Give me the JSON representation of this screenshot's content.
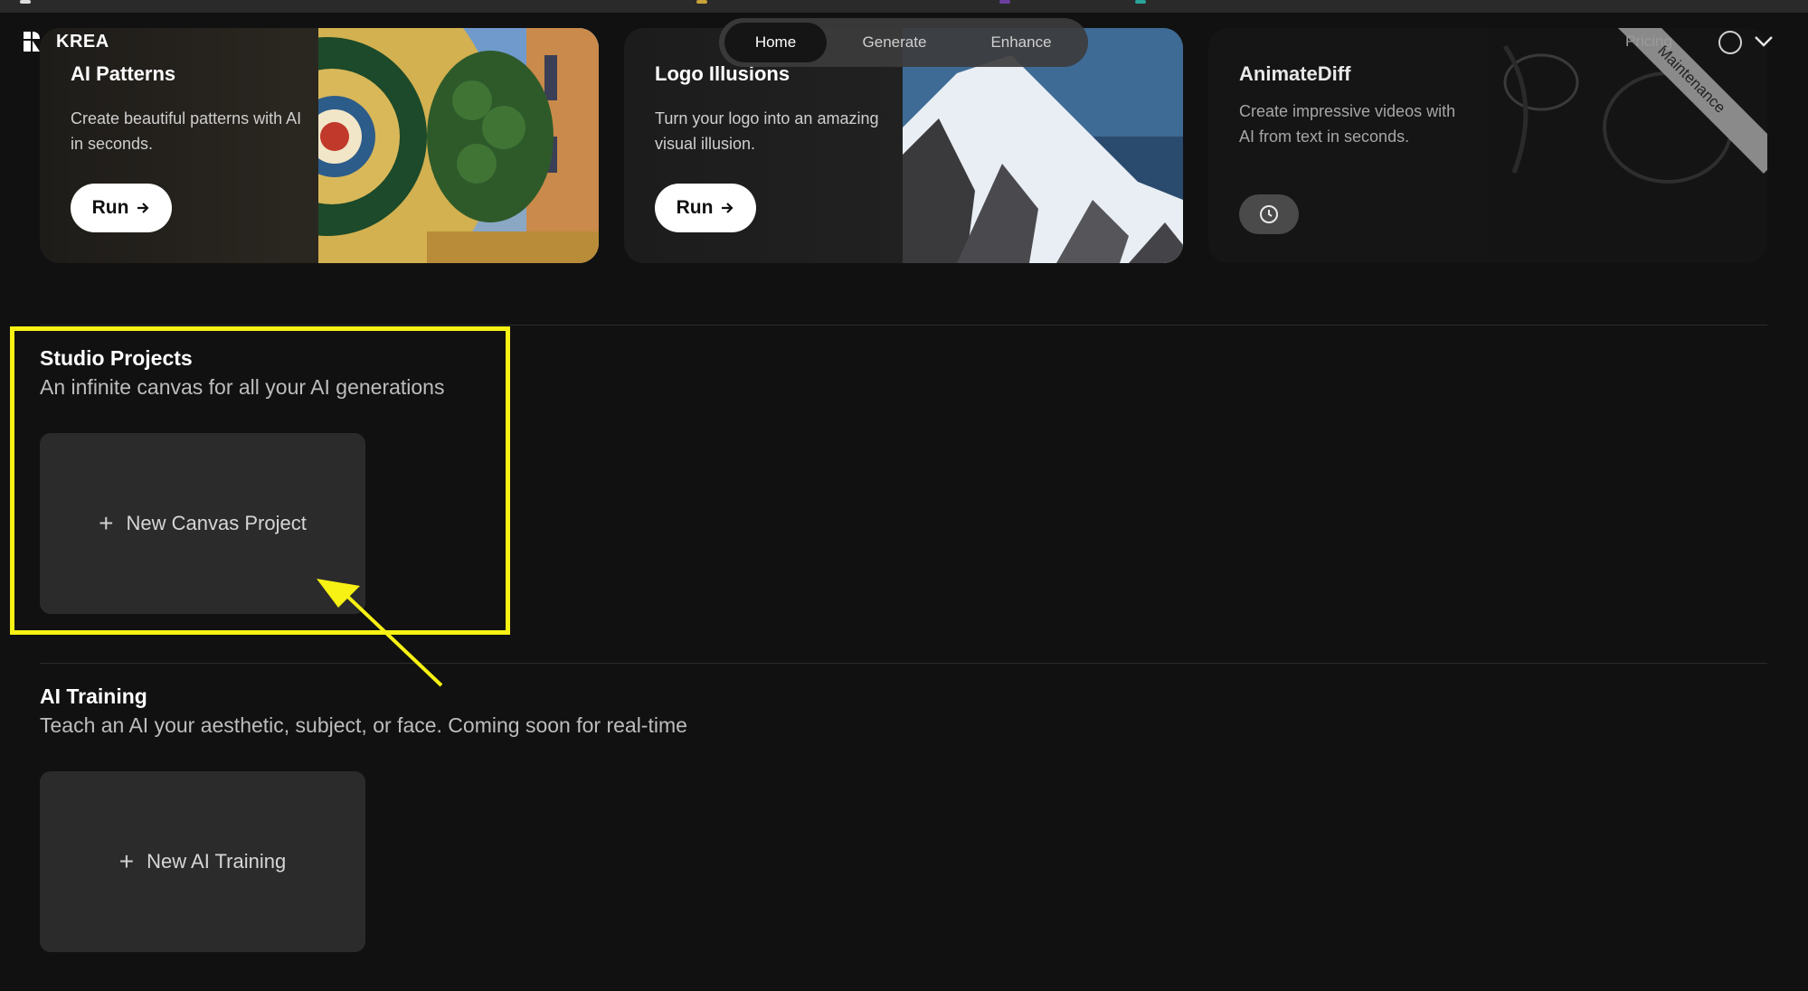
{
  "app": {
    "brand": "KREA"
  },
  "nav": {
    "tabs": [
      "Home",
      "Generate",
      "Enhance"
    ],
    "active": "Home",
    "pricing": "Pricing"
  },
  "cards": [
    {
      "title": "AI Patterns",
      "description": "Create beautiful patterns with AI in seconds.",
      "button": "Run"
    },
    {
      "title": "Logo Illusions",
      "description": "Turn your logo into an amazing visual illusion.",
      "button": "Run"
    },
    {
      "title": "AnimateDiff",
      "description": "Create impressive videos with AI from text in seconds.",
      "ribbon": "Maintenance"
    }
  ],
  "studio": {
    "title": "Studio Projects",
    "subtitle": "An infinite canvas for all your AI generations",
    "new_label": "New Canvas Project"
  },
  "training": {
    "title": "AI Training",
    "subtitle": "Teach an AI your aesthetic, subject, or face. Coming soon for real-time",
    "new_label": "New AI Training"
  },
  "colors": {
    "background": "#111111",
    "highlight": "#f7f114",
    "tile": "#2b2b2b"
  },
  "icons": [
    "krea-logo-icon",
    "arrow-right-icon",
    "clock-icon",
    "plus-icon",
    "chevron-down-icon"
  ]
}
